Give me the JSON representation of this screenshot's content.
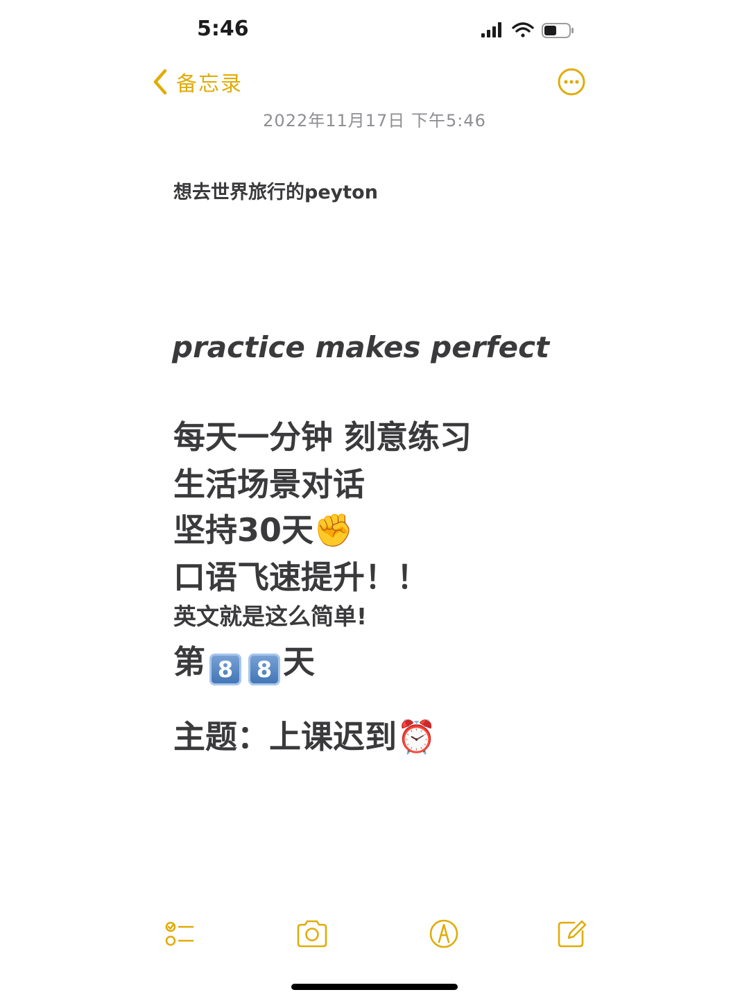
{
  "status_bar": {
    "time": "5:46",
    "icons": [
      "cellular-signal-icon",
      "wifi-icon",
      "battery-icon"
    ]
  },
  "nav": {
    "back_label": "备忘录",
    "back_icon": "chevron-left-icon",
    "more_icon": "ellipsis-circle-icon"
  },
  "note": {
    "date": "2022年11月17日 下午5:46",
    "title": "想去世界旅行的peyton",
    "motto": "practice makes perfect",
    "lines": [
      "每天一分钟 刻意练习",
      "生活场景对话",
      "坚持30天",
      "口语飞速提升！！",
      "英文就是这么简单!",
      "第",
      "天",
      "主题：上课迟到"
    ],
    "emoji": {
      "fist": "✊",
      "keycap_digits": [
        "8",
        "8"
      ],
      "alarm_clock": "⏰"
    }
  },
  "toolbar": {
    "items": [
      "checklist-icon",
      "camera-icon",
      "markup-pen-icon",
      "compose-icon"
    ]
  },
  "colors": {
    "accent": "#e0ac08",
    "text": "#3a3a3c",
    "secondary_text": "#8e8e93",
    "background": "#ffffff"
  }
}
